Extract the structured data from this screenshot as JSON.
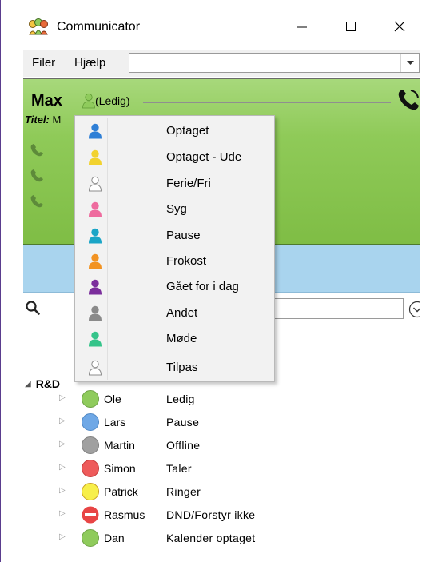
{
  "window": {
    "title": "Communicator"
  },
  "menubar": {
    "file": "Filer",
    "help": "Hjælp",
    "combo_value": ""
  },
  "user": {
    "name": "Max",
    "status": "(Ledig)",
    "title_label": "Titel:",
    "title_value": "M"
  },
  "status_menu": {
    "items": [
      {
        "label": "Optaget",
        "color": "#2f7fd6"
      },
      {
        "label": "Optaget - Ude",
        "color": "#f2d22e"
      },
      {
        "label": "Ferie/Fri",
        "color": "#ffffff"
      },
      {
        "label": "Syg",
        "color": "#ee6b9e"
      },
      {
        "label": "Pause",
        "color": "#1aa5c7"
      },
      {
        "label": "Frokost",
        "color": "#f29322"
      },
      {
        "label": "Gået for i dag",
        "color": "#7b2e9c"
      },
      {
        "label": "Andet",
        "color": "#8a8a8a"
      },
      {
        "label": "Møde",
        "color": "#35c48a"
      },
      {
        "label": "Tilpas",
        "color": "#ffffff"
      }
    ]
  },
  "group": {
    "name": "R&D"
  },
  "contacts": [
    {
      "name": "Ole",
      "status": "Ledig",
      "color": "#8fcb5c"
    },
    {
      "name": "Lars",
      "status": "Pause",
      "color": "#6fa8e6"
    },
    {
      "name": "Martin",
      "status": "Offline",
      "color": "#a0a0a0"
    },
    {
      "name": "Simon",
      "status": "Taler",
      "color": "#ee5b5b"
    },
    {
      "name": "Patrick",
      "status": "Ringer",
      "color": "#f7ef4a"
    },
    {
      "name": "Rasmus",
      "status": "DND/Forstyr ikke",
      "color": "#e84545"
    },
    {
      "name": "Dan",
      "status": "Kalender optaget",
      "color": "#8fcb5c"
    }
  ],
  "colors": {
    "panel_green": "#8fca58",
    "band_blue": "#a9d4ee",
    "accent_border": "#5a3d8e"
  }
}
